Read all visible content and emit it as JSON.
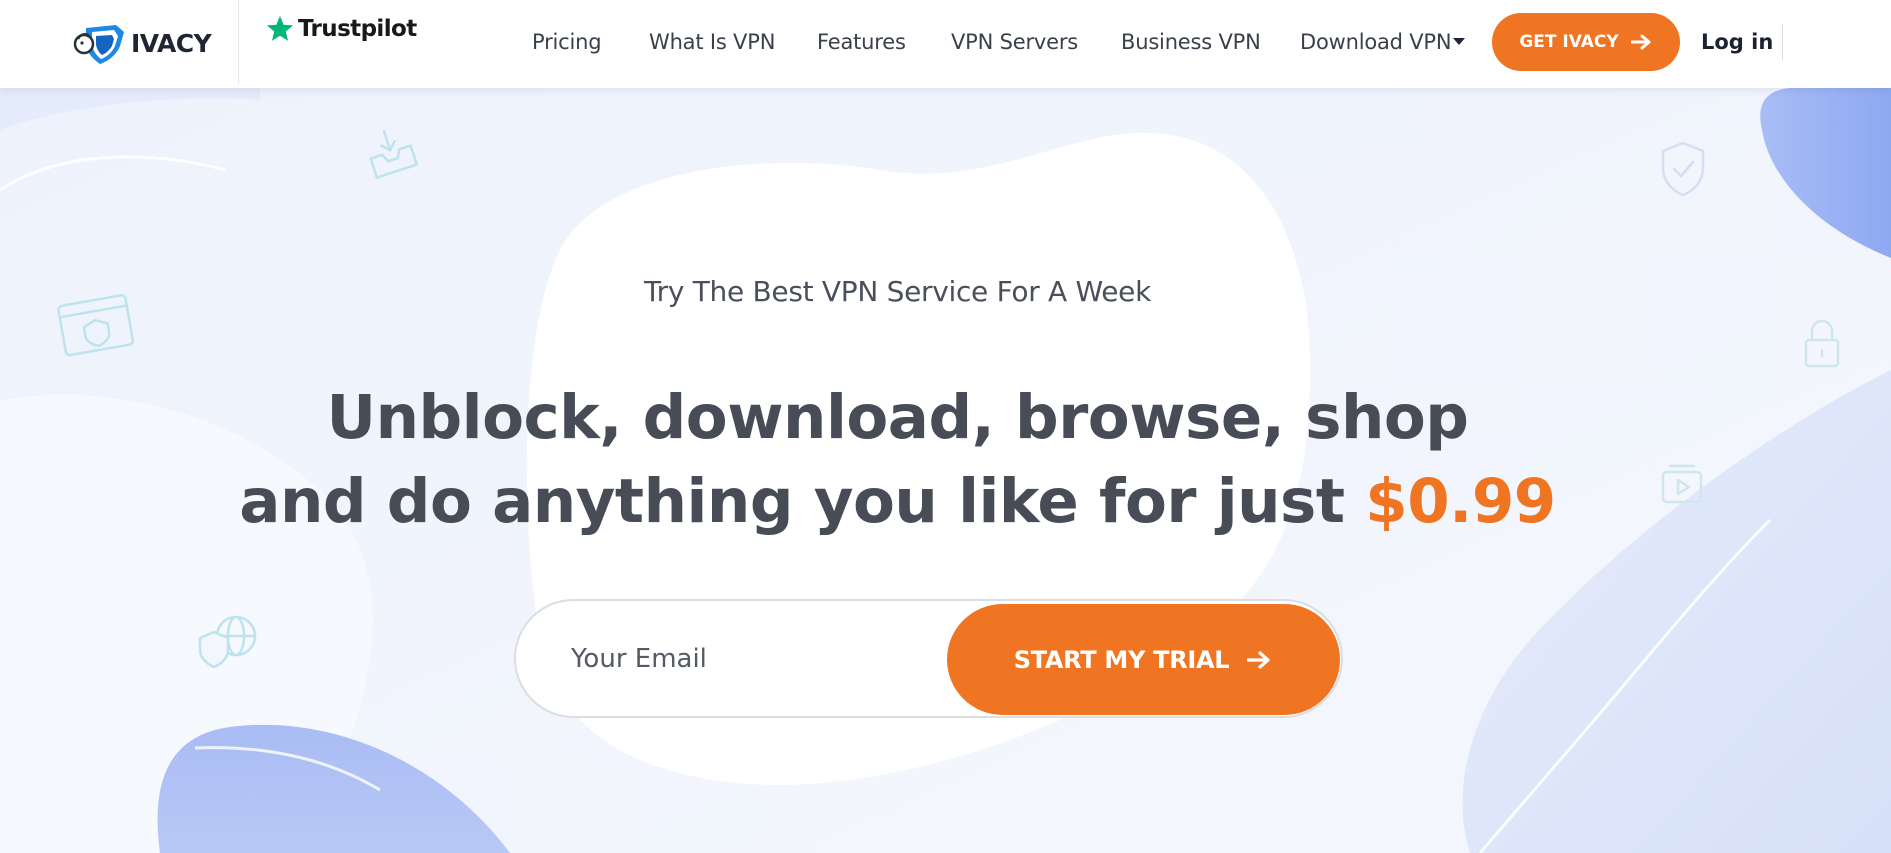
{
  "header": {
    "logo_text": "IVACY",
    "trustpilot_text": "Trustpilot",
    "nav": [
      {
        "label": "Pricing"
      },
      {
        "label": "What Is VPN"
      },
      {
        "label": "Features"
      },
      {
        "label": "VPN Servers"
      },
      {
        "label": "Business VPN"
      },
      {
        "label": "Download VPN"
      }
    ],
    "cta_label": "GET IVACY",
    "login_label": "Log in"
  },
  "hero": {
    "eyebrow": "Try The Best VPN Service For A Week",
    "headline_line1": "Unblock, download, browse, shop",
    "headline_line2": "and do anything you like for just ",
    "price": "$0.99",
    "email_placeholder": "Your Email",
    "trial_button_label": "START MY TRIAL"
  },
  "colors": {
    "accent": "#f07522",
    "text_dark": "#474c57",
    "trustpilot_green": "#00b67a",
    "logo_blue": "#1e88e5"
  },
  "icons": [
    "ivacy-logo-icon",
    "trustpilot-star-icon",
    "caret-down-icon",
    "arrow-right-icon",
    "download-box-icon",
    "browser-shield-icon",
    "shield-globe-icon",
    "shield-check-icon",
    "padlock-icon",
    "video-play-icon"
  ]
}
